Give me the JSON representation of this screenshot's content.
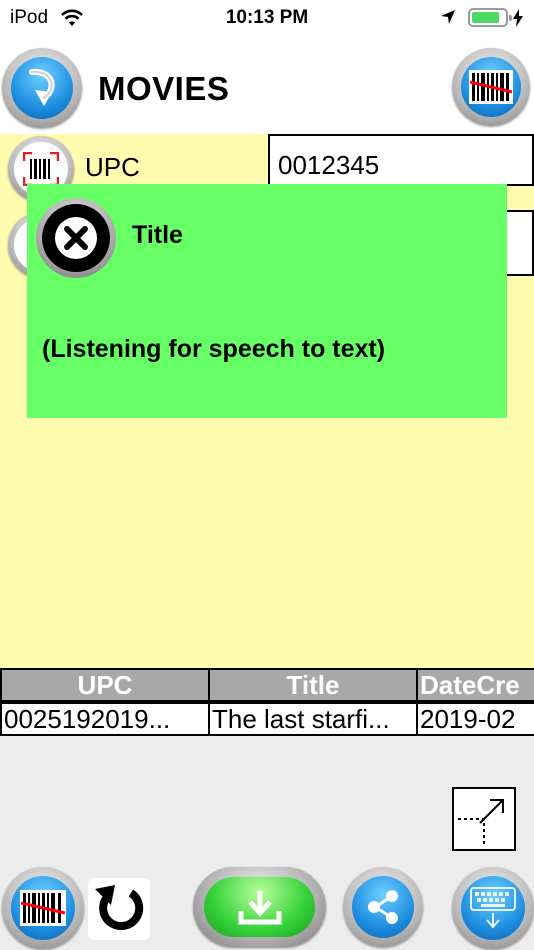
{
  "status_bar": {
    "carrier": "iPod",
    "time": "10:13 PM"
  },
  "header": {
    "title": "MOVIES"
  },
  "form": {
    "upc_label": "UPC",
    "upc_value": "0012345"
  },
  "dialog": {
    "title": "Title",
    "message": "(Listening for speech to text)"
  },
  "table": {
    "columns": [
      "UPC",
      "Title",
      "DateCre"
    ],
    "rows": [
      [
        "0025192019...",
        "The last starfi...",
        "2019-02"
      ]
    ]
  },
  "colors": {
    "form_background": "#fffcb0",
    "dialog_background": "#66ff66",
    "button_blue": "#1e8fe0",
    "button_green": "#36d23a",
    "table_header": "#a8a8a8",
    "battery_green": "#4cd964"
  },
  "icons": {
    "back": "back-arrow-icon",
    "scan_top": "barcode-scan-icon",
    "upc_field": "barcode-icon",
    "dialog_close": "close-icon",
    "expand": "expand-icon",
    "undo": "undo-icon",
    "download": "download-icon",
    "share": "share-icon",
    "keyboard": "keyboard-icon"
  },
  "battery_level": 0.85
}
